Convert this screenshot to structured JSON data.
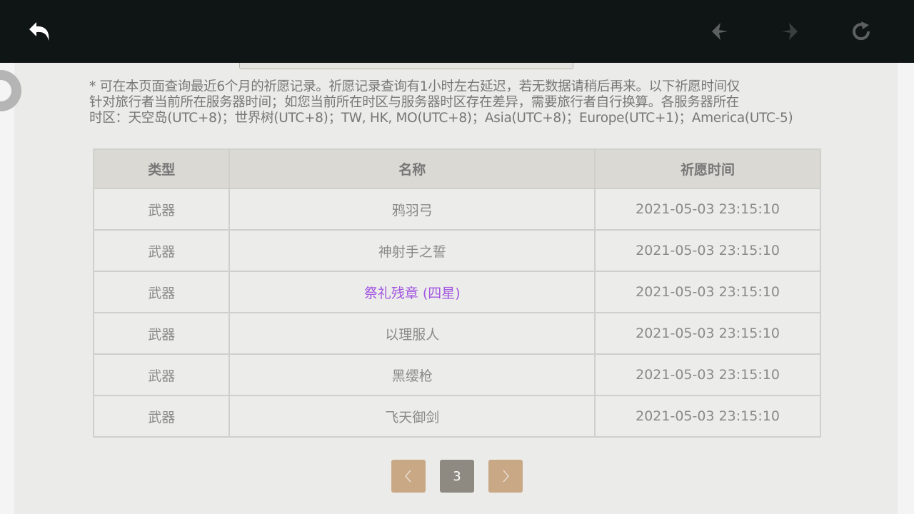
{
  "notice": {
    "line1": "* 可在本页面查询最近6个月的祈愿记录。祈愿记录查询有1小时左右延迟，若无数据请稍后再来。以下祈愿时间仅",
    "line2": "针对旅行者当前所在服务器时间；如您当前所在时区与服务器时区存在差异，需要旅行者自行换算。各服务器所在",
    "line3": "时区：天空岛(UTC+8)；世界树(UTC+8)；TW, HK, MO(UTC+8)；Asia(UTC+8)；Europe(UTC+1)；America(UTC-5)"
  },
  "table": {
    "headers": [
      "类型",
      "名称",
      "祈愿时间"
    ],
    "rows": [
      {
        "type": "武器",
        "name": "鸦羽弓",
        "time": "2021-05-03 23:15:10"
      },
      {
        "type": "武器",
        "name": "神射手之誓",
        "time": "2021-05-03 23:15:10"
      },
      {
        "type": "武器",
        "name": "祭礼残章 (四星)",
        "time": "2021-05-03 23:15:10",
        "highlight": "#a256e1"
      },
      {
        "type": "武器",
        "name": "以理服人",
        "time": "2021-05-03 23:15:10"
      },
      {
        "type": "武器",
        "name": "黑缨枪",
        "time": "2021-05-03 23:15:10"
      },
      {
        "type": "武器",
        "name": "飞天御剑",
        "time": "2021-05-03 23:15:10"
      }
    ]
  },
  "pagination": {
    "prev_icon": "chevron-left-icon",
    "current_page": "3",
    "next_icon": "chevron-right-icon"
  },
  "toolbar": {
    "back_icon": "back-arrow-icon",
    "prev_icon": "prev-arrow-icon",
    "next_icon": "next-arrow-icon",
    "reload_icon": "reload-icon"
  },
  "colors": {
    "topbar": "#0f1414",
    "page_bg": "#ebebe9",
    "header_bg": "#dbd9d4",
    "pager_button": "#c9a886",
    "pager_current": "#8e8a81",
    "four_star": "#a256e1"
  }
}
